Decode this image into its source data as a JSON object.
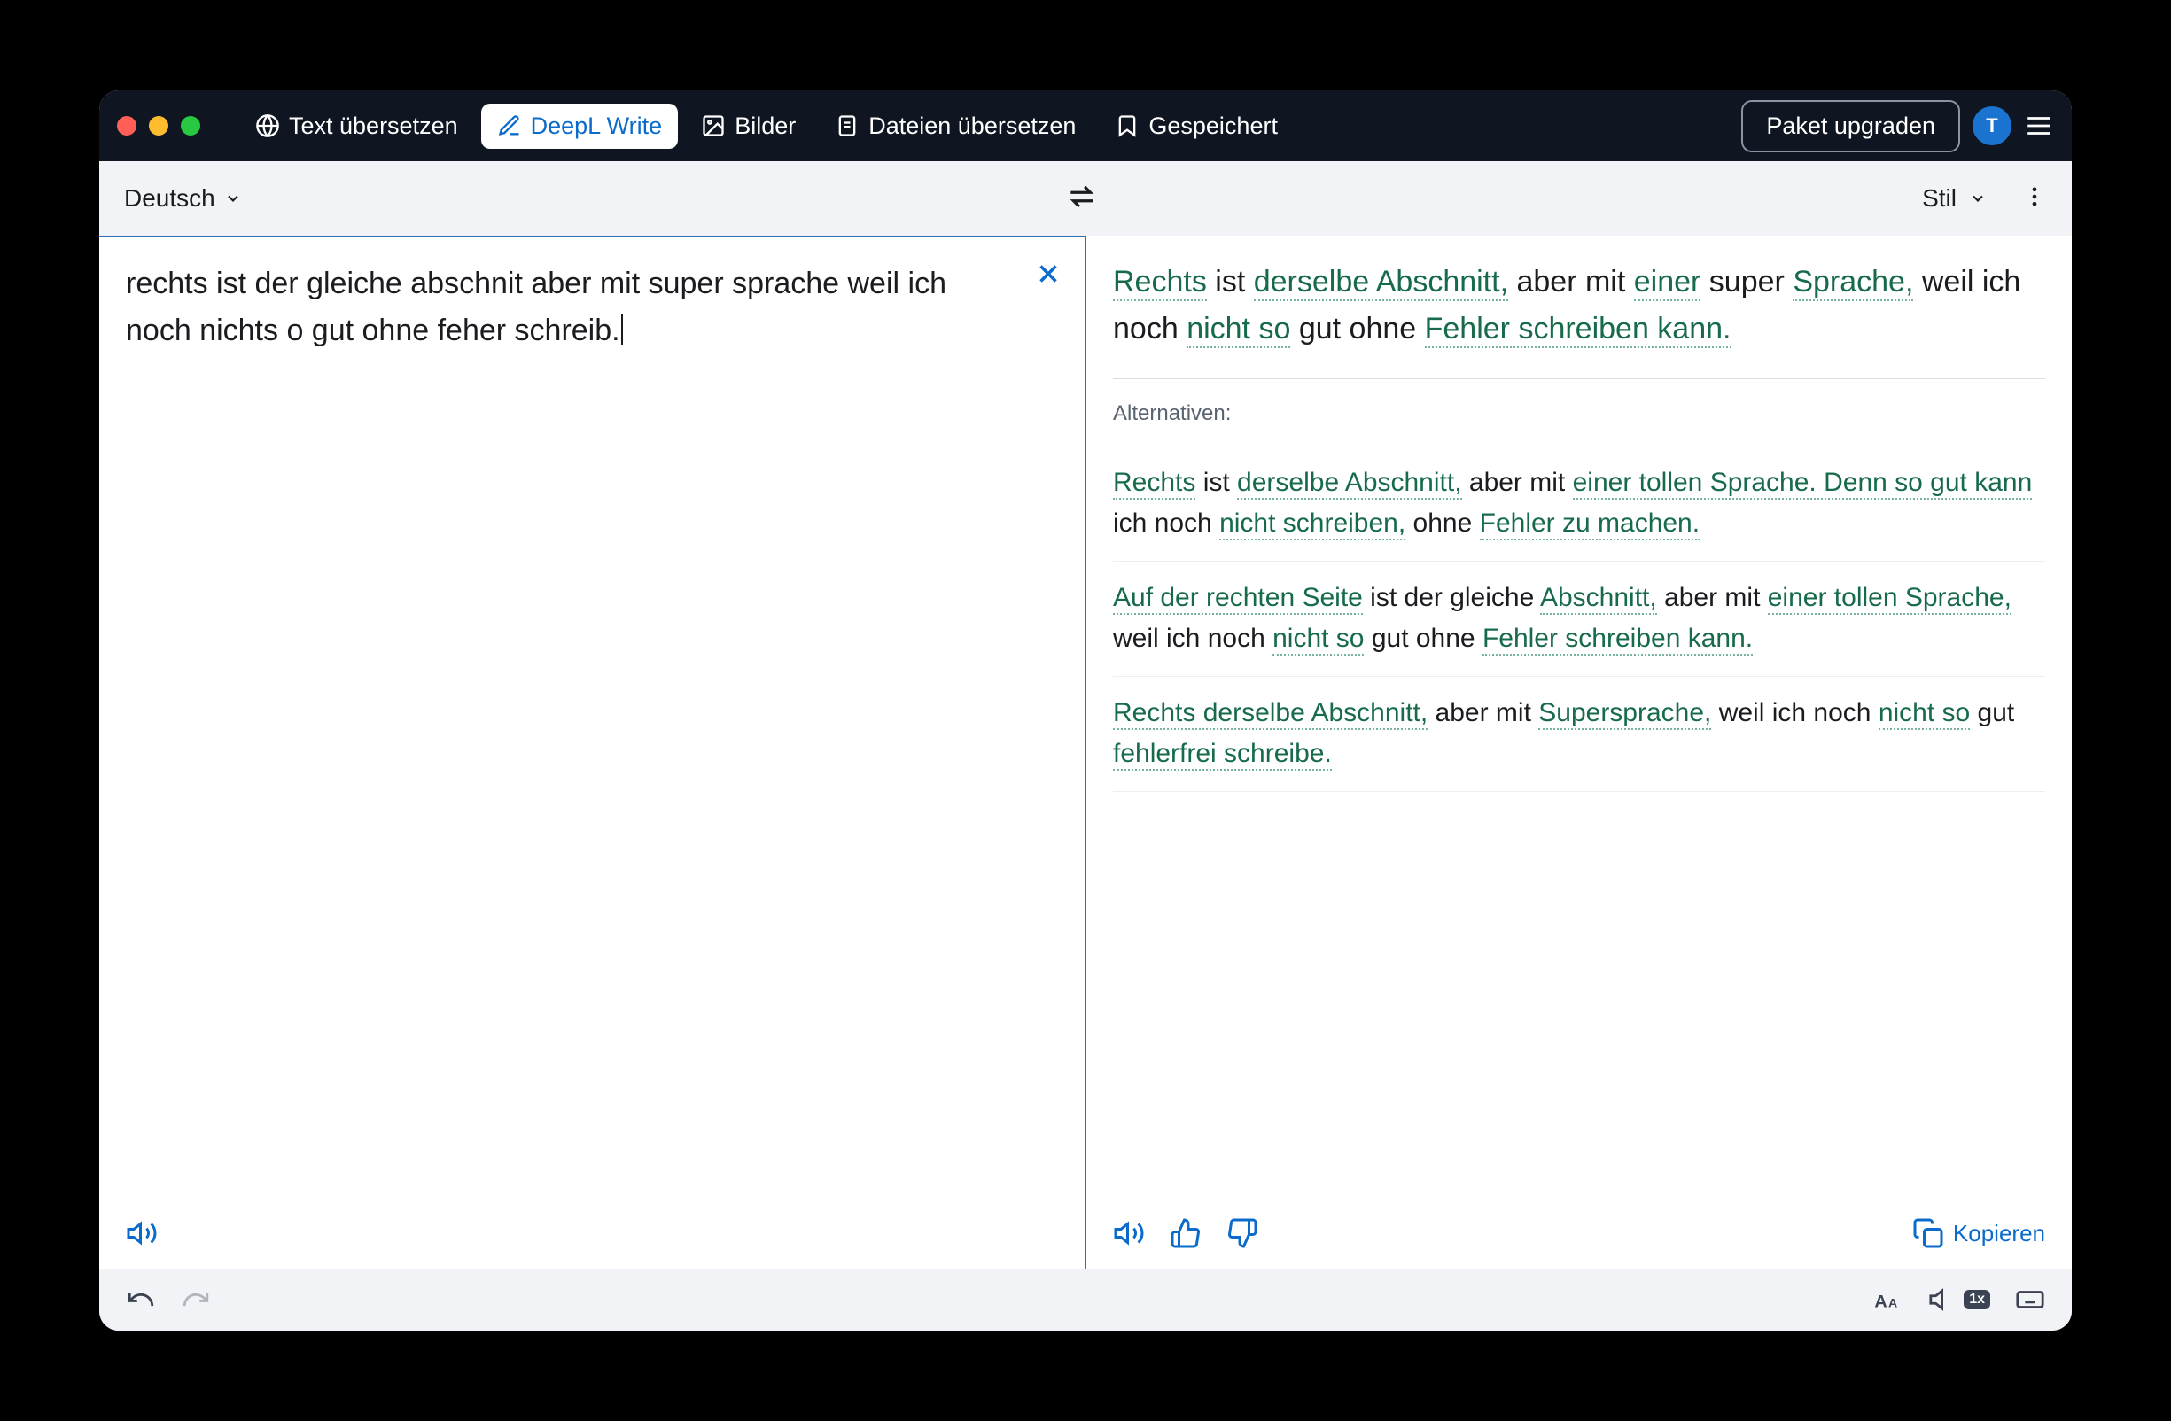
{
  "nav": {
    "tabs": [
      {
        "label": "Text übersetzen",
        "icon": "globe-icon"
      },
      {
        "label": "DeepL Write",
        "icon": "pencil-icon",
        "active": true
      },
      {
        "label": "Bilder",
        "icon": "image-icon"
      },
      {
        "label": "Dateien übersetzen",
        "icon": "document-icon"
      },
      {
        "label": "Gespeichert",
        "icon": "bookmark-icon"
      }
    ],
    "upgrade_label": "Paket upgraden",
    "avatar_initial": "T"
  },
  "toolbar": {
    "source_language_label": "Deutsch",
    "style_label": "Stil"
  },
  "input": {
    "text": "rechts ist der gleiche abschnit aber mit super sprache weil ich noch nichts o gut ohne feher schreib."
  },
  "output": {
    "main_segments": [
      {
        "t": "Rechts",
        "hl": true
      },
      {
        "t": " ist ",
        "hl": false
      },
      {
        "t": "derselbe Abschnitt,",
        "hl": true
      },
      {
        "t": " aber mit ",
        "hl": false
      },
      {
        "t": "einer",
        "hl": true
      },
      {
        "t": " super ",
        "hl": false
      },
      {
        "t": "Sprache,",
        "hl": true
      },
      {
        "t": " weil ich noch ",
        "hl": false
      },
      {
        "t": "nicht so",
        "hl": true
      },
      {
        "t": " gut ohne ",
        "hl": false
      },
      {
        "t": "Fehler schreiben kann.",
        "hl": true
      }
    ],
    "alternatives_label": "Alternativen:",
    "alternatives": [
      [
        {
          "t": "Rechts",
          "hl": true
        },
        {
          "t": " ist ",
          "hl": false
        },
        {
          "t": "derselbe Abschnitt,",
          "hl": true
        },
        {
          "t": " aber mit ",
          "hl": false
        },
        {
          "t": "einer tollen Sprache. Denn so gut kann",
          "hl": true
        },
        {
          "t": " ich noch ",
          "hl": false
        },
        {
          "t": "nicht schreiben,",
          "hl": true
        },
        {
          "t": " ohne ",
          "hl": false
        },
        {
          "t": "Fehler zu machen.",
          "hl": true
        }
      ],
      [
        {
          "t": "Auf der rechten Seite",
          "hl": true
        },
        {
          "t": " ist der gleiche ",
          "hl": false
        },
        {
          "t": "Abschnitt,",
          "hl": true
        },
        {
          "t": " aber mit ",
          "hl": false
        },
        {
          "t": "einer tollen Sprache,",
          "hl": true
        },
        {
          "t": " weil ich noch ",
          "hl": false
        },
        {
          "t": "nicht so",
          "hl": true
        },
        {
          "t": " gut ohne ",
          "hl": false
        },
        {
          "t": "Fehler schreiben kann.",
          "hl": true
        }
      ],
      [
        {
          "t": "Rechts derselbe Abschnitt,",
          "hl": true
        },
        {
          "t": " aber mit ",
          "hl": false
        },
        {
          "t": "Supersprache,",
          "hl": true
        },
        {
          "t": " weil ich noch ",
          "hl": false
        },
        {
          "t": "nicht so",
          "hl": true
        },
        {
          "t": " gut ",
          "hl": false
        },
        {
          "t": "fehlerfrei schreibe.",
          "hl": true
        }
      ]
    ],
    "copy_label": "Kopieren"
  },
  "bottombar": {
    "speed_label": "1x"
  }
}
